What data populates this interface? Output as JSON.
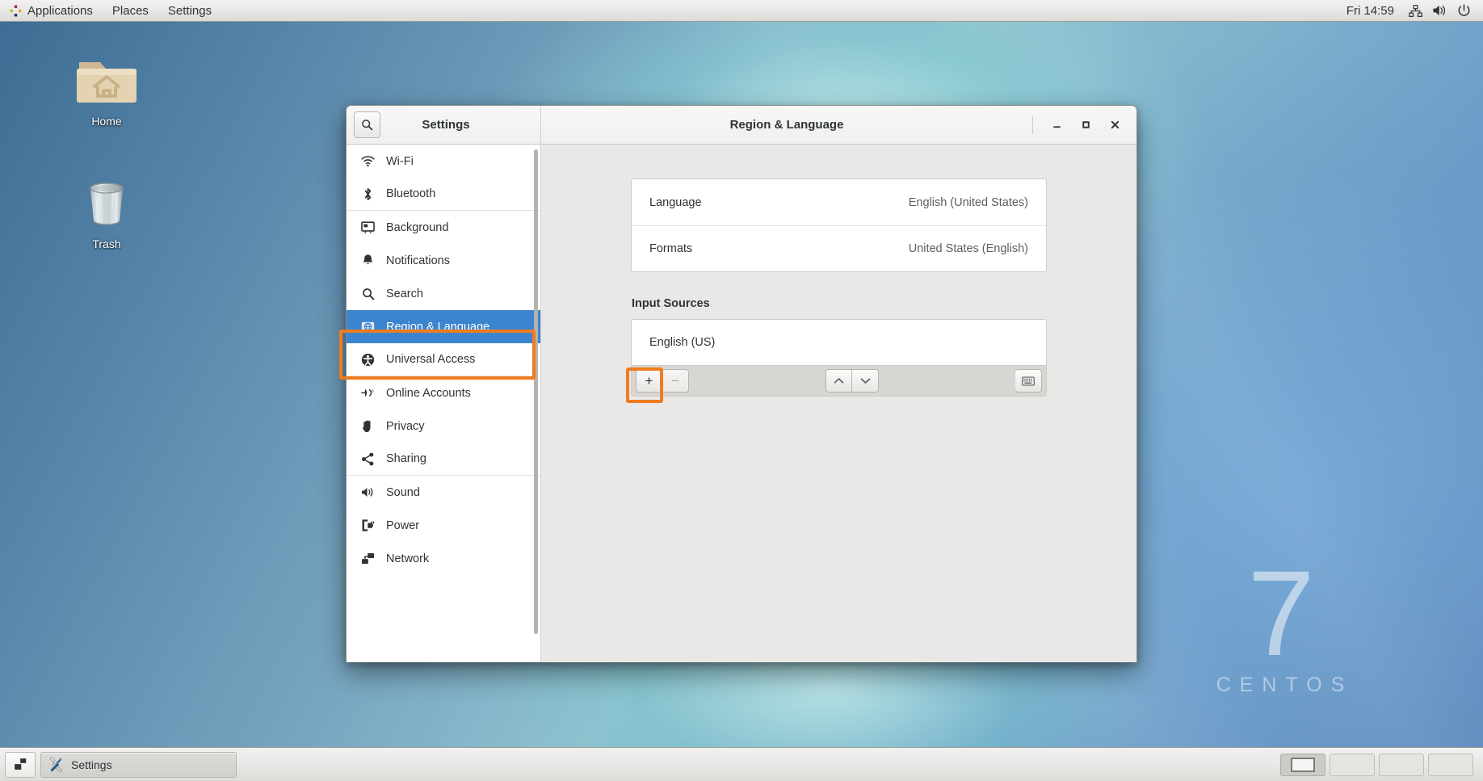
{
  "top_panel": {
    "menus": [
      {
        "label": "Applications",
        "icon": "centos-logo-icon"
      },
      {
        "label": "Places",
        "icon": null
      },
      {
        "label": "Settings",
        "icon": null
      }
    ],
    "clock": "Fri 14:59",
    "tray_icons": [
      "network-icon",
      "volume-icon",
      "power-icon"
    ]
  },
  "desktop": {
    "icons": [
      {
        "name": "home",
        "label": "Home",
        "icon": "home-folder-icon"
      },
      {
        "name": "trash",
        "label": "Trash",
        "icon": "trash-can-icon"
      }
    ],
    "watermark": {
      "number": "7",
      "word": "CENTOS"
    }
  },
  "window": {
    "app_title": "Settings",
    "panel_title": "Region & Language",
    "search_icon": "search-icon",
    "controls": {
      "minimize": "minimize-icon",
      "maximize": "maximize-icon",
      "close": "close-icon"
    }
  },
  "sidebar": {
    "items": [
      {
        "label": "Wi-Fi",
        "icon": "wifi-icon",
        "selected": false,
        "group_end": false
      },
      {
        "label": "Bluetooth",
        "icon": "bluetooth-icon",
        "selected": false,
        "group_end": true
      },
      {
        "label": "Background",
        "icon": "background-icon",
        "selected": false,
        "group_end": false
      },
      {
        "label": "Notifications",
        "icon": "bell-icon",
        "selected": false,
        "group_end": false
      },
      {
        "label": "Search",
        "icon": "search-icon",
        "selected": false,
        "group_end": false
      },
      {
        "label": "Region & Language",
        "icon": "region-language-icon",
        "selected": true,
        "group_end": false
      },
      {
        "label": "Universal Access",
        "icon": "universal-access-icon",
        "selected": false,
        "group_end": true
      },
      {
        "label": "Online Accounts",
        "icon": "online-accounts-icon",
        "selected": false,
        "group_end": false
      },
      {
        "label": "Privacy",
        "icon": "privacy-hand-icon",
        "selected": false,
        "group_end": false
      },
      {
        "label": "Sharing",
        "icon": "share-icon",
        "selected": false,
        "group_end": true
      },
      {
        "label": "Sound",
        "icon": "sound-icon",
        "selected": false,
        "group_end": false
      },
      {
        "label": "Power",
        "icon": "power-plug-icon",
        "selected": false,
        "group_end": false
      },
      {
        "label": "Network",
        "icon": "network-icon",
        "selected": false,
        "group_end": false
      }
    ],
    "selected_color": "#3b85d0"
  },
  "main": {
    "rows": [
      {
        "label": "Language",
        "value": "English (United States)"
      },
      {
        "label": "Formats",
        "value": "United States (English)"
      }
    ],
    "input_sources": {
      "heading": "Input Sources",
      "items": [
        {
          "label": "English (US)"
        }
      ],
      "toolbar": {
        "add": "+",
        "remove": "−",
        "move_up": "chevron-up-icon",
        "move_down": "chevron-down-icon",
        "keyboard_preview": "keyboard-icon"
      }
    }
  },
  "annotations": {
    "color": "#f07c1e",
    "boxes": [
      {
        "target": "sidebar-item-region-language"
      },
      {
        "target": "input-source-add-button"
      }
    ]
  },
  "taskbar": {
    "show_desktop": "show-desktop-icon",
    "windows": [
      {
        "label": "Settings",
        "icon": "settings-tools-icon",
        "active": true
      }
    ],
    "workspaces": [
      {
        "index": 1,
        "active": true
      },
      {
        "index": 2,
        "active": false
      },
      {
        "index": 3,
        "active": false
      },
      {
        "index": 4,
        "active": false
      }
    ]
  }
}
